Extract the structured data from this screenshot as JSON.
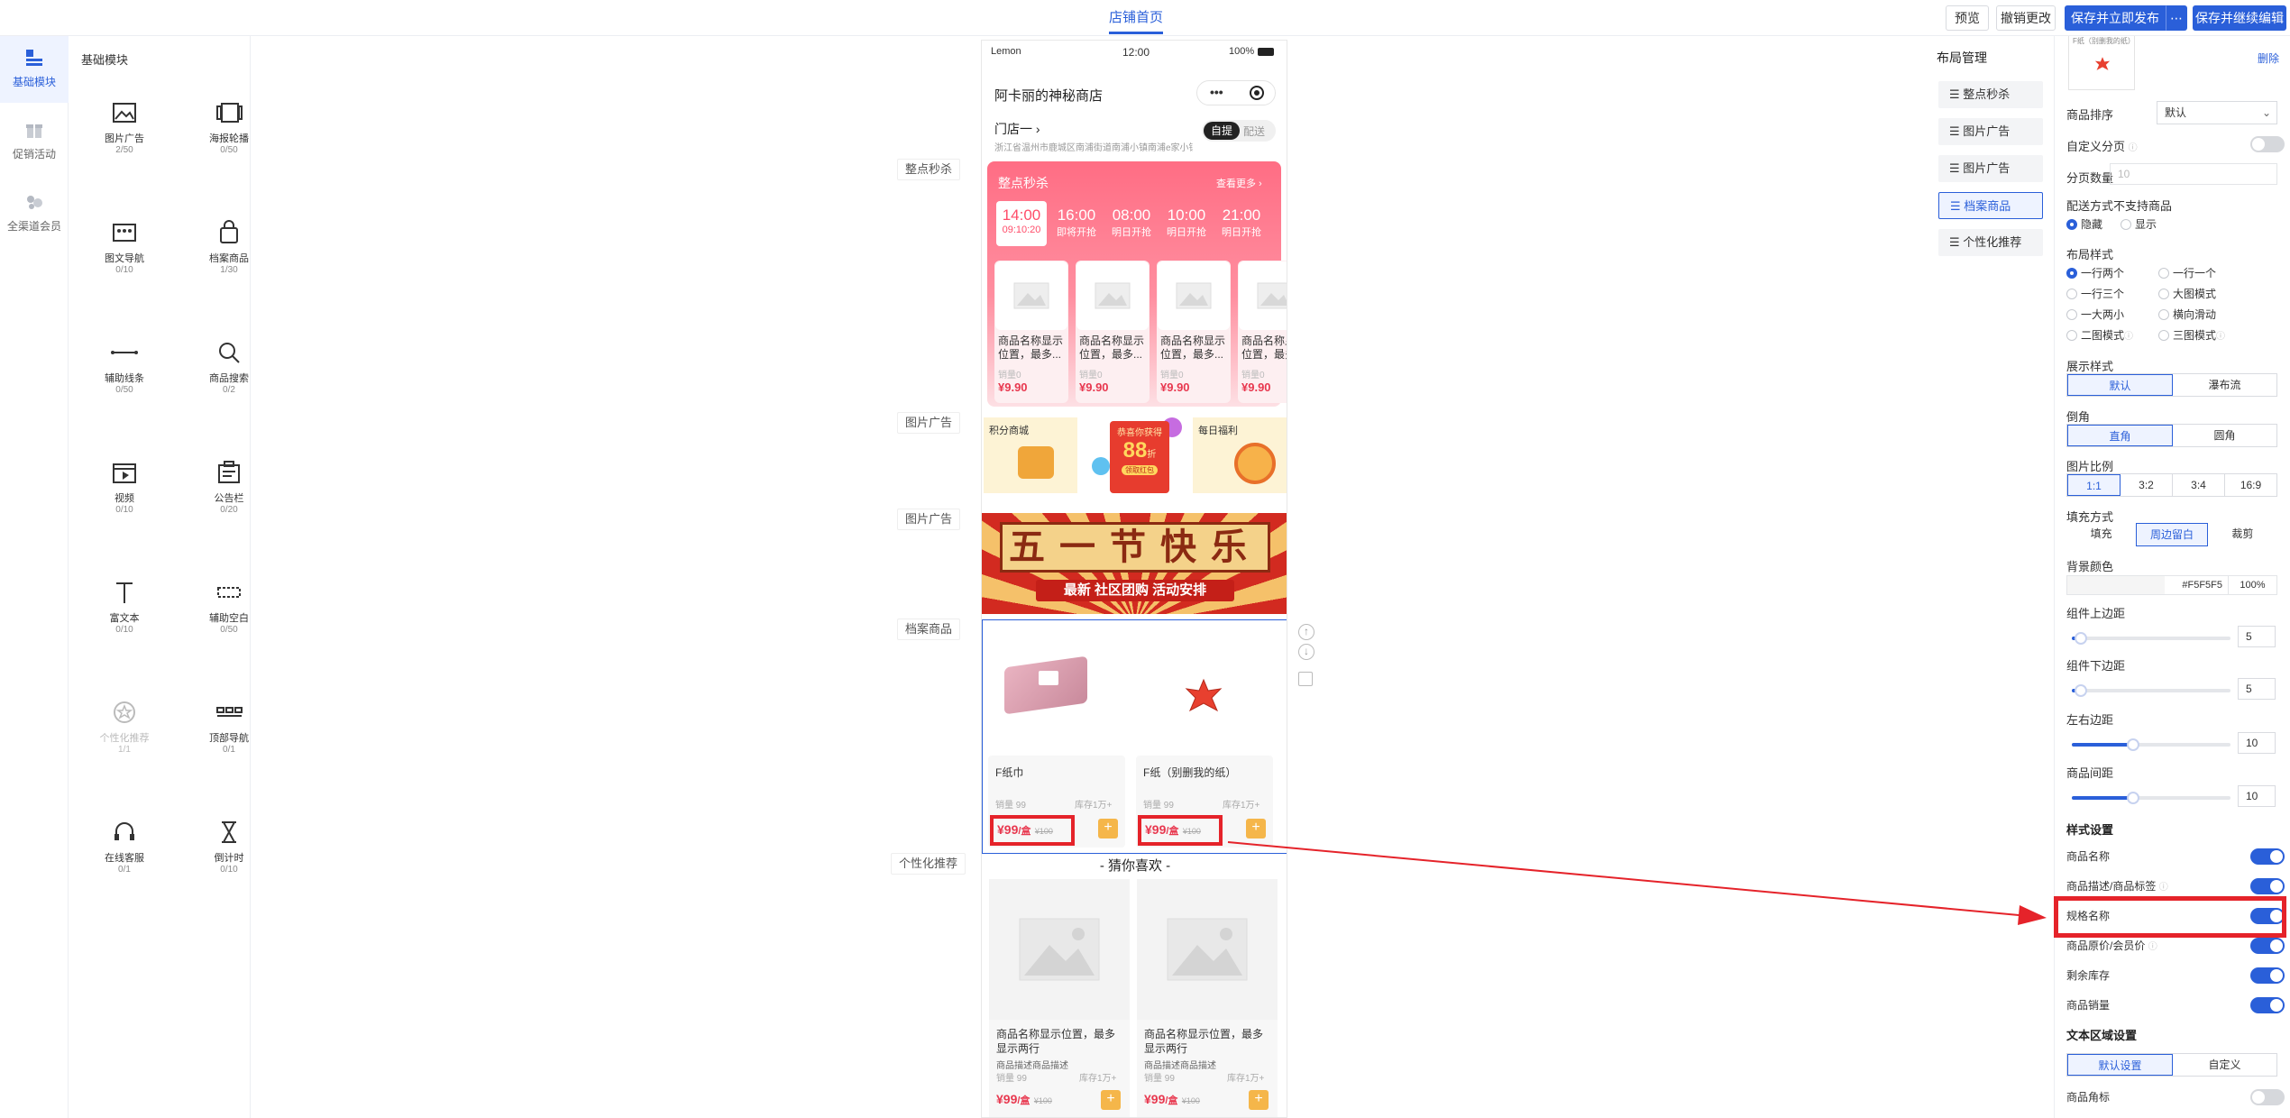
{
  "topbar": {
    "title": "店铺首页",
    "buttons": {
      "preview": "预览",
      "undo": "撤销更改",
      "save_publish": "保存并立即发布",
      "more": "⋯",
      "save_continue": "保存并继续编辑"
    }
  },
  "leftnav": [
    {
      "label": "基础模块",
      "icon": "layout-icon"
    },
    {
      "label": "促销活动",
      "icon": "gift-icon"
    },
    {
      "label": "全渠道会员",
      "icon": "member-icon"
    }
  ],
  "modules": {
    "title": "基础模块",
    "items": [
      {
        "name": "图片广告",
        "count": "2/50",
        "icon": "image-icon"
      },
      {
        "name": "海报轮播",
        "count": "0/50",
        "icon": "carousel-icon"
      },
      {
        "name": "图文导航",
        "count": "0/10",
        "icon": "nav-grid-icon"
      },
      {
        "name": "档案商品",
        "count": "1/30",
        "icon": "bag-icon"
      },
      {
        "name": "辅助线条",
        "count": "0/50",
        "icon": "line-icon"
      },
      {
        "name": "商品搜索",
        "count": "0/2",
        "icon": "search-icon"
      },
      {
        "name": "视频",
        "count": "0/10",
        "icon": "video-icon"
      },
      {
        "name": "公告栏",
        "count": "0/20",
        "icon": "notice-icon"
      },
      {
        "name": "富文本",
        "count": "0/10",
        "icon": "text-icon"
      },
      {
        "name": "辅助空白",
        "count": "0/50",
        "icon": "blank-icon"
      },
      {
        "name": "个性化推荐",
        "count": "1/1",
        "icon": "star-icon",
        "disabled": true
      },
      {
        "name": "顶部导航",
        "count": "0/1",
        "icon": "topnav-icon"
      },
      {
        "name": "在线客服",
        "count": "0/1",
        "icon": "headset-icon"
      },
      {
        "name": "倒计时",
        "count": "0/10",
        "icon": "hourglass-icon"
      }
    ]
  },
  "canvas_labels": {
    "flash": "整点秒杀",
    "ad1": "图片广告",
    "ad2": "图片广告",
    "archive": "档案商品",
    "rec": "个性化推荐"
  },
  "phone": {
    "status": {
      "carrier": "Lemon",
      "time": "12:00",
      "battery": "100%"
    },
    "shop_name": "阿卡丽的神秘商店",
    "store": "门店一",
    "address": "浙江省温州市鹿城区南浦街道南浦小镇南浦e家小镇",
    "delivery_tabs": [
      "自提",
      "配送"
    ],
    "flash": {
      "title": "整点秒杀",
      "more": "查看更多 ›",
      "slots": [
        {
          "time": "14:00",
          "sub": "09:10:20"
        },
        {
          "time": "16:00",
          "sub": "即将开抢"
        },
        {
          "time": "08:00",
          "sub": "明日开抢"
        },
        {
          "time": "10:00",
          "sub": "明日开抢"
        },
        {
          "time": "21:00",
          "sub": "明日开抢"
        }
      ],
      "cards": [
        {
          "name": "商品名称显示位置，最多...",
          "sales": "销量0",
          "price": "¥9.90"
        },
        {
          "name": "商品名称显示位置，最多...",
          "sales": "销量0",
          "price": "¥9.90"
        },
        {
          "name": "商品名称显示位置，最多...",
          "sales": "销量0",
          "price": "¥9.90"
        },
        {
          "name": "商品名称显示位置，最多...",
          "sales": "销量0",
          "price": "¥9.90"
        }
      ]
    },
    "ad1": {
      "left": "积分商城",
      "center_title": "恭喜你获得",
      "center_amount": "88",
      "center_unit": "折",
      "center_btn": "领取红包",
      "right": "每日福利"
    },
    "ad2": {
      "title": "五一节快乐",
      "sub": "最新 社区团购 活动安排"
    },
    "archive": [
      {
        "name": "F纸巾",
        "sales": "销量 99",
        "stock": "库存1万+",
        "price": "¥99",
        "unit": "/盒",
        "orig": "¥100"
      },
      {
        "name": "F纸（别删我的纸）",
        "sales": "销量 99",
        "stock": "库存1万+",
        "price": "¥99",
        "unit": "/盒",
        "orig": "¥100"
      }
    ],
    "guess": {
      "title": "- 猜你喜欢 -",
      "cards": [
        {
          "name": "商品名称显示位置，最多显示两行",
          "desc": "商品描述商品描述",
          "sales": "销量 99",
          "stock": "库存1万+",
          "price": "¥99",
          "unit": "/盒",
          "orig": "¥100"
        },
        {
          "name": "商品名称显示位置，最多显示两行",
          "desc": "商品描述商品描述",
          "sales": "销量 99",
          "stock": "库存1万+",
          "price": "¥99",
          "unit": "/盒",
          "orig": "¥100"
        }
      ]
    }
  },
  "layout_panel": {
    "title": "布局管理",
    "items": [
      "整点秒杀",
      "图片广告",
      "图片广告",
      "档案商品",
      "个性化推荐"
    ],
    "active_index": 3
  },
  "settings": {
    "thumb_caption": "F纸（别删我的纸）",
    "delete": "删除",
    "sort_label": "商品排序",
    "sort_value": "默认",
    "custom_page": "自定义分页",
    "page_count_label": "分页数量",
    "page_count_value": "10",
    "unsupported_label": "配送方式不支持商品",
    "unsupported_opts": [
      "隐藏",
      "显示"
    ],
    "layout_label": "布局样式",
    "layout_opts": [
      "一行两个",
      "一行一个",
      "一行三个",
      "大图模式",
      "一大两小",
      "横向滑动",
      "二图模式",
      "三图模式"
    ],
    "display_label": "展示样式",
    "display_opts": [
      "默认",
      "瀑布流"
    ],
    "corner_label": "倒角",
    "corner_opts": [
      "直角",
      "圆角"
    ],
    "ratio_label": "图片比例",
    "ratio_opts": [
      "1:1",
      "3:2",
      "3:4",
      "16:9"
    ],
    "fill_label": "填充方式",
    "fill_opts": [
      "填充",
      "周边留白",
      "裁剪"
    ],
    "bg_label": "背景颜色",
    "bg_hex": "#F5F5F5",
    "bg_alpha": "100%",
    "top_margin_label": "组件上边距",
    "top_margin": "5",
    "bottom_margin_label": "组件下边距",
    "bottom_margin": "5",
    "lr_margin_label": "左右边距",
    "lr_margin": "10",
    "gap_label": "商品间距",
    "gap": "10",
    "style_title": "样式设置",
    "toggles": [
      {
        "label": "商品名称",
        "on": true
      },
      {
        "label": "商品描述/商品标签",
        "on": true
      },
      {
        "label": "规格名称",
        "on": true
      },
      {
        "label": "商品原价/会员价",
        "on": true
      },
      {
        "label": "剩余库存",
        "on": true
      },
      {
        "label": "商品销量",
        "on": true
      }
    ],
    "text_area_title": "文本区域设置",
    "text_area_opts": [
      "默认设置",
      "自定义"
    ],
    "corner_mark_label": "商品角标",
    "corner_mark_on": false
  },
  "colors": {
    "accent": "#2a5fd9",
    "highlight": "#e5232a",
    "price": "#e8384f"
  }
}
